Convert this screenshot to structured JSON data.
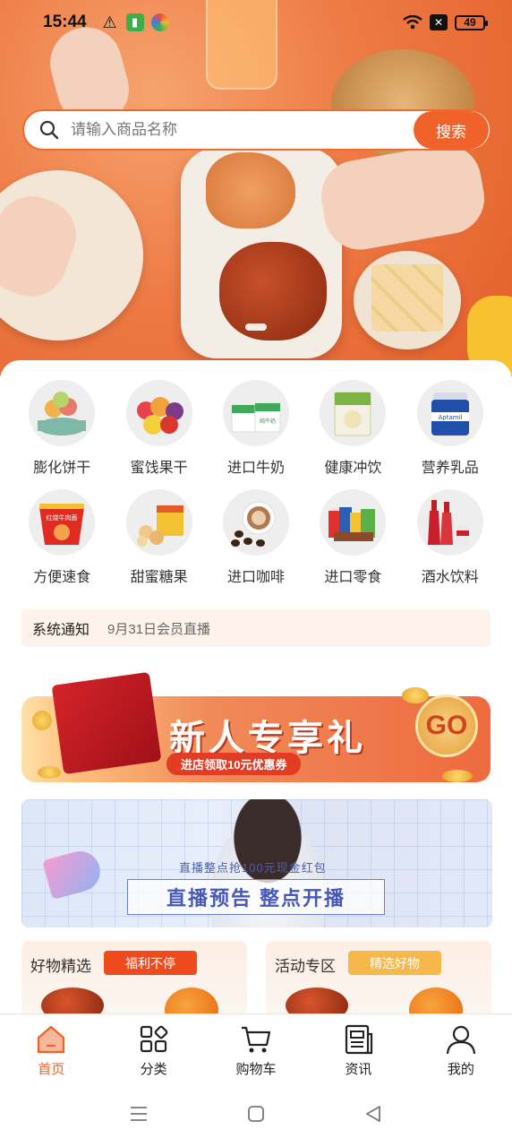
{
  "status_bar": {
    "time": "15:44",
    "battery": "49"
  },
  "search": {
    "placeholder": "请输入商品名称",
    "button_label": "搜索"
  },
  "categories": [
    {
      "label": "膨化饼干",
      "icon": "macaron-icon"
    },
    {
      "label": "蜜饯果干",
      "icon": "dried-fruit-icon"
    },
    {
      "label": "进口牛奶",
      "icon": "milk-icon"
    },
    {
      "label": "健康冲饮",
      "icon": "cereal-drink-icon"
    },
    {
      "label": "营养乳品",
      "icon": "formula-icon"
    },
    {
      "label": "方便速食",
      "icon": "instant-noodle-icon"
    },
    {
      "label": "甜蜜糖果",
      "icon": "candy-icon"
    },
    {
      "label": "进口咖啡",
      "icon": "coffee-icon"
    },
    {
      "label": "进口零食",
      "icon": "snacks-icon"
    },
    {
      "label": "酒水饮料",
      "icon": "beverage-icon"
    }
  ],
  "category_pack_text": {
    "milk": "纯牛奶",
    "formula": "Aptamil",
    "noodle": "红烧牛肉面"
  },
  "notice": {
    "title": "系统通知",
    "text": "9月31日会员直播"
  },
  "promo": {
    "title": "新人专享礼",
    "subtitle": "进店领取10元优惠券",
    "go_label": "GO"
  },
  "live": {
    "subtitle": "直播整点抢100元现金红包",
    "title": "直播预告 整点开播"
  },
  "sections": [
    {
      "title": "好物精选",
      "tag": "福利不停"
    },
    {
      "title": "活动专区",
      "tag": "精选好物"
    }
  ],
  "tabs": [
    {
      "label": "首页",
      "active": true,
      "icon": "home-icon"
    },
    {
      "label": "分类",
      "active": false,
      "icon": "category-icon"
    },
    {
      "label": "购物车",
      "active": false,
      "icon": "cart-icon"
    },
    {
      "label": "资讯",
      "active": false,
      "icon": "news-icon"
    },
    {
      "label": "我的",
      "active": false,
      "icon": "user-icon"
    }
  ],
  "colors": {
    "accent": "#f0622a",
    "notice_bg": "#fdf2ec"
  }
}
